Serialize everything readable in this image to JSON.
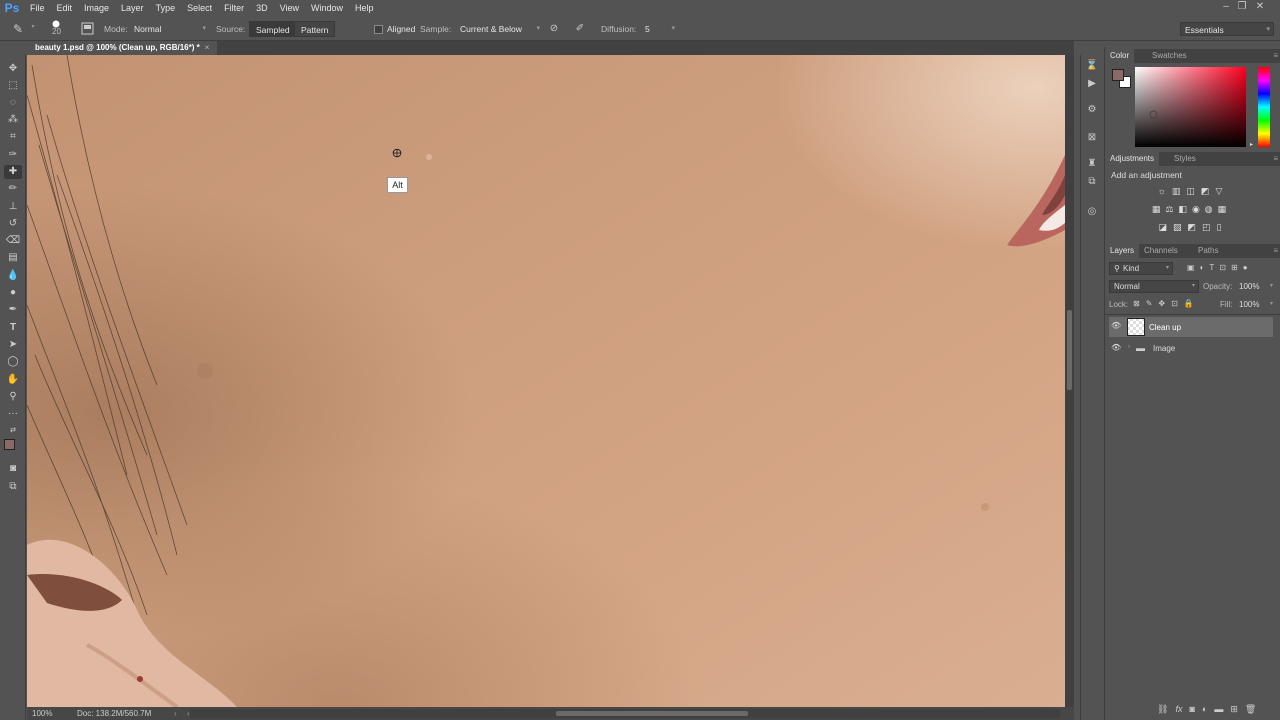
{
  "app": {
    "logo": "Ps"
  },
  "menubar": {
    "items": [
      "File",
      "Edit",
      "Image",
      "Layer",
      "Type",
      "Select",
      "Filter",
      "3D",
      "View",
      "Window",
      "Help"
    ]
  },
  "options": {
    "brush_size": "20",
    "mode_label": "Mode:",
    "mode_value": "Normal",
    "source_label": "Source:",
    "sampled_label": "Sampled",
    "pattern_label": "Pattern",
    "aligned_label": "Aligned",
    "sample_label": "Sample:",
    "sample_value": "Current & Below",
    "diffusion_label": "Diffusion:",
    "diffusion_value": "5",
    "workspace": "Essentials"
  },
  "document": {
    "tab_title": "beauty 1.psd @ 100% (Clean up, RGB/16*) *",
    "close": "×"
  },
  "canvas": {
    "tooltip": "Alt"
  },
  "status": {
    "zoom": "100%",
    "doc_size": "Doc: 138.2M/560.7M"
  },
  "color_panel": {
    "tabs": [
      "Color",
      "Swatches"
    ]
  },
  "adjustments_panel": {
    "tabs": [
      "Adjustments",
      "Styles"
    ],
    "heading": "Add an adjustment"
  },
  "layers_panel": {
    "tabs": [
      "Layers",
      "Channels",
      "Paths"
    ],
    "filter_kind": "Kind",
    "blend_mode": "Normal",
    "opacity_label": "Opacity:",
    "opacity_value": "100%",
    "lock_label": "Lock:",
    "fill_label": "Fill:",
    "fill_value": "100%",
    "layers": [
      {
        "name": "Clean up",
        "selected": true
      },
      {
        "name": "Image",
        "selected": false
      }
    ]
  },
  "colors": {
    "foreground": "#8a6a66",
    "background": "#ffffff",
    "skin": "#c89b7b"
  }
}
